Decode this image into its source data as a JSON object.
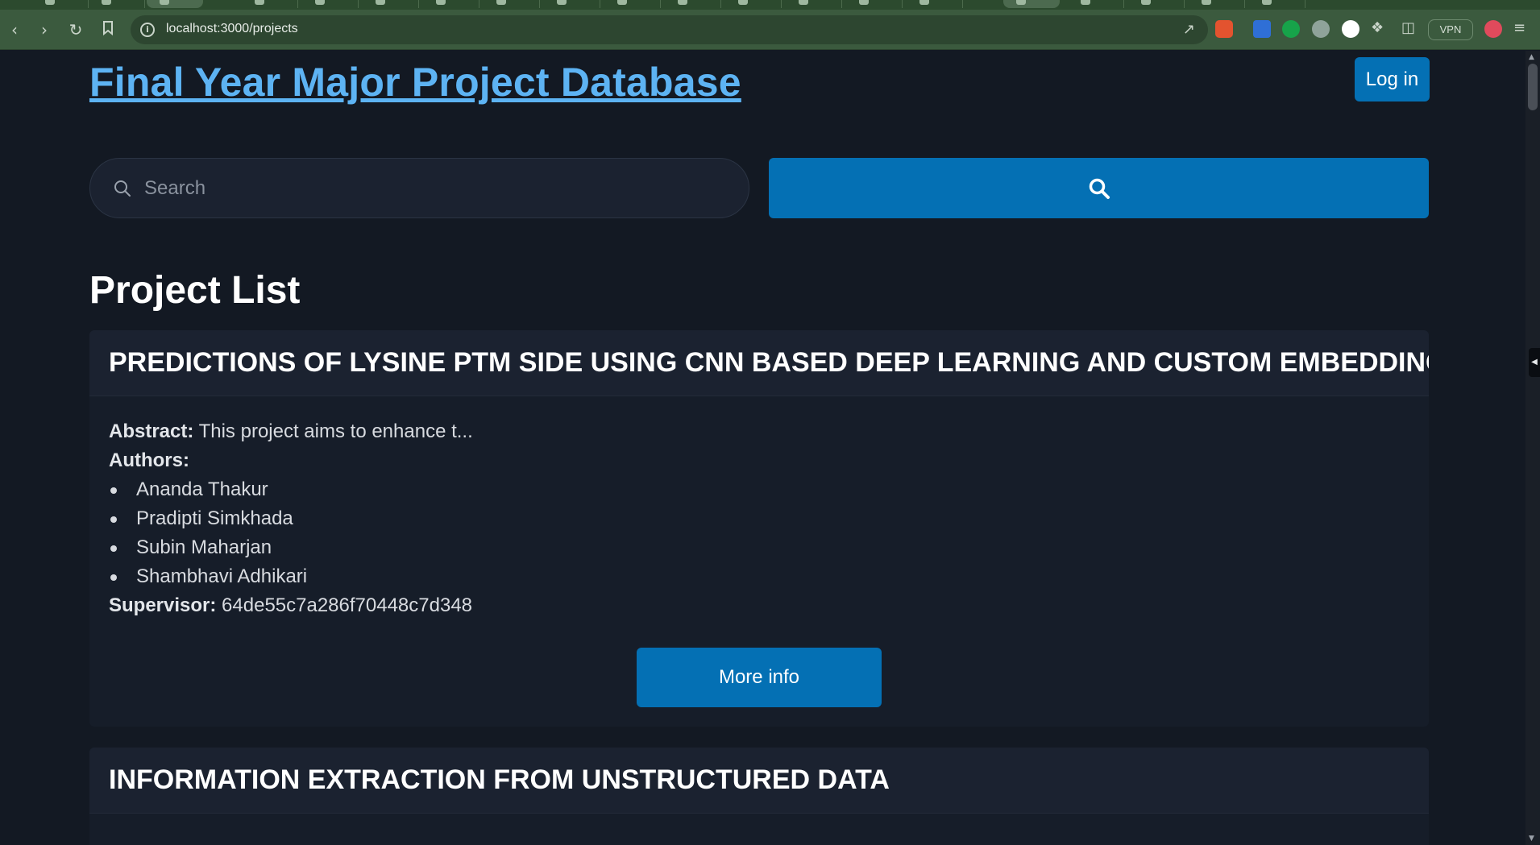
{
  "browser": {
    "url": "localhost:3000/projects",
    "vpn_label": "VPN",
    "back_icon": "chevron-left-icon",
    "forward_icon": "chevron-right-icon",
    "reload_icon": "reload-icon",
    "bookmark_icon": "bookmark-icon",
    "colors": {
      "toolbar": "#3b5a3e",
      "tabstrip": "#2c4a2e",
      "omnibox": "#2d4630"
    }
  },
  "header": {
    "site_title": "Final Year Major Project Database",
    "login_label": "Log in"
  },
  "search": {
    "placeholder": "Search",
    "value": "",
    "button_icon": "search-icon"
  },
  "main": {
    "heading": "Project List",
    "projects": [
      {
        "title": "PREDICTIONS OF LYSINE PTM SIDE USING CNN BASED DEEP LEARNING AND CUSTOM EMBEDDING",
        "abstract_label": "Abstract:",
        "abstract": "This project aims to enhance t...",
        "authors_label": "Authors:",
        "authors": [
          "Ananda Thakur",
          "Pradipti Simkhada",
          "Subin Maharjan",
          "Shambhavi Adhikari"
        ],
        "supervisor_label": "Supervisor:",
        "supervisor": "64de55c7a286f70448c7d348",
        "button_label": "More info"
      },
      {
        "title": "INFORMATION EXTRACTION FROM UNSTRUCTURED DATA"
      }
    ]
  },
  "theme": {
    "page_background": "#131923",
    "card_background": "#161d29",
    "card_header_background": "#1b2230",
    "accent": "#0470b4",
    "link": "#5db3f3"
  }
}
